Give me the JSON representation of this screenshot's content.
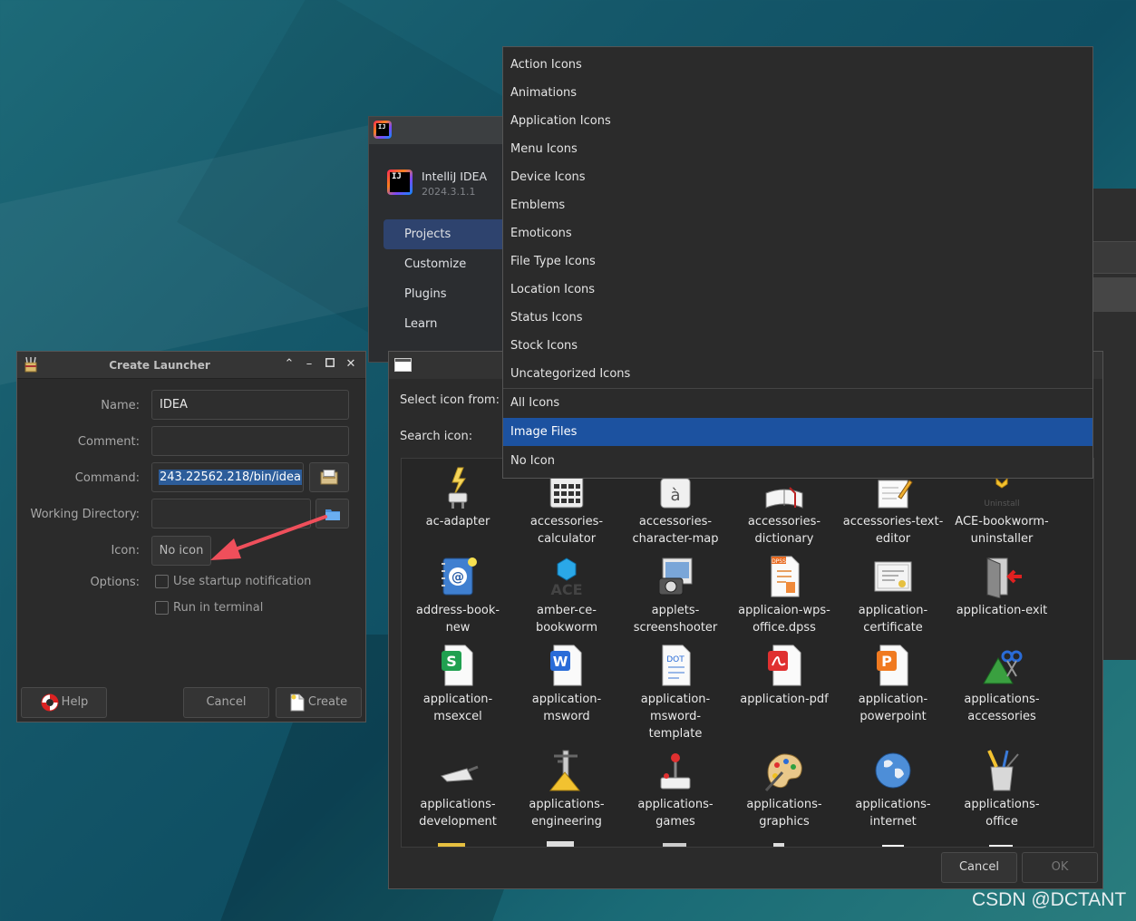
{
  "intellij": {
    "name": "IntelliJ IDEA",
    "version": "2024.3.1.1",
    "nav": [
      "Projects",
      "Customize",
      "Plugins",
      "Learn"
    ]
  },
  "launcher": {
    "title": "Create Launcher",
    "labels": {
      "name": "Name:",
      "comment": "Comment:",
      "command": "Command:",
      "workdir": "Working Directory:",
      "icon": "Icon:",
      "options": "Options:"
    },
    "values": {
      "name": "IDEA",
      "comment": "",
      "command": "243.22562.218/bin/idea",
      "workdir": ""
    },
    "icon_button": "No icon",
    "options": {
      "startup": "Use startup notification",
      "terminal": "Run in terminal"
    },
    "buttons": {
      "help": "Help",
      "cancel": "Cancel",
      "create": "Create"
    }
  },
  "select_icon": {
    "select_label": "Select icon from:",
    "search_label": "Search icon:",
    "icons": [
      {
        "l1": "ac-adapter",
        "l2": "",
        "l3": ""
      },
      {
        "l1": "accessories-",
        "l2": "calculator",
        "l3": ""
      },
      {
        "l1": "accessories-",
        "l2": "character-map",
        "l3": ""
      },
      {
        "l1": "accessories-",
        "l2": "dictionary",
        "l3": ""
      },
      {
        "l1": "accessories-text-",
        "l2": "editor",
        "l3": ""
      },
      {
        "l1": "ACE-bookworm-",
        "l2": "uninstaller",
        "l3": ""
      },
      {
        "l1": "address-book-",
        "l2": "new",
        "l3": ""
      },
      {
        "l1": "amber-ce-",
        "l2": "bookworm",
        "l3": ""
      },
      {
        "l1": "applets-",
        "l2": "screenshooter",
        "l3": ""
      },
      {
        "l1": "applicaion-wps-",
        "l2": "office.dpss",
        "l3": ""
      },
      {
        "l1": "application-",
        "l2": "certificate",
        "l3": ""
      },
      {
        "l1": "application-exit",
        "l2": "",
        "l3": ""
      },
      {
        "l1": "application-",
        "l2": "msexcel",
        "l3": ""
      },
      {
        "l1": "application-",
        "l2": "msword",
        "l3": ""
      },
      {
        "l1": "application-",
        "l2": "msword-",
        "l3": "template"
      },
      {
        "l1": "application-pdf",
        "l2": "",
        "l3": ""
      },
      {
        "l1": "application-",
        "l2": "powerpoint",
        "l3": ""
      },
      {
        "l1": "applications-",
        "l2": "accessories",
        "l3": ""
      },
      {
        "l1": "applications-",
        "l2": "development",
        "l3": ""
      },
      {
        "l1": "applications-",
        "l2": "engineering",
        "l3": ""
      },
      {
        "l1": "applications-",
        "l2": "games",
        "l3": ""
      },
      {
        "l1": "applications-",
        "l2": "graphics",
        "l3": ""
      },
      {
        "l1": "applications-",
        "l2": "internet",
        "l3": ""
      },
      {
        "l1": "applications-",
        "l2": "office",
        "l3": ""
      }
    ],
    "icon_badges": {
      "uninstall": "Uninstall",
      "dpss": "DPSS",
      "dot": "DOT",
      "ace": "ACE"
    },
    "buttons": {
      "cancel": "Cancel",
      "ok": "OK"
    }
  },
  "dropdown": {
    "items": [
      "Action Icons",
      "Animations",
      "Application Icons",
      "Menu Icons",
      "Device Icons",
      "Emblems",
      "Emoticons",
      "File Type Icons",
      "Location Icons",
      "Status Icons",
      "Stock Icons",
      "Uncategorized Icons",
      "All Icons",
      "Image Files",
      "No Icon"
    ],
    "selected": "Image Files"
  },
  "watermark": "CSDN @DCTANT"
}
